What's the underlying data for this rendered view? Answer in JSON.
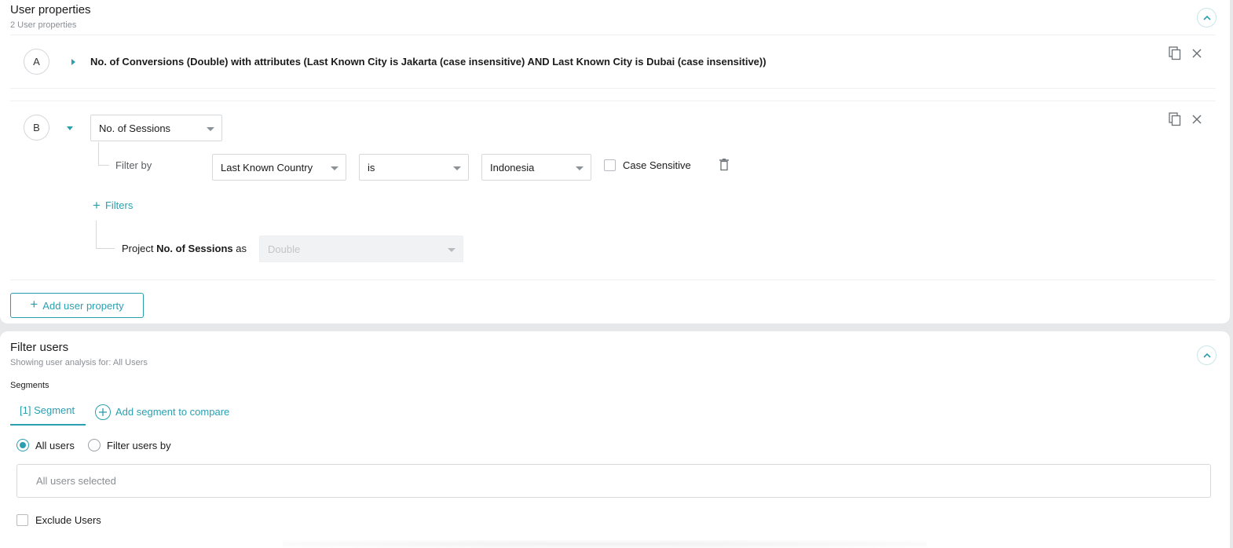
{
  "user_properties": {
    "title": "User properties",
    "subtitle": "2 User properties",
    "rows": [
      {
        "letter": "A",
        "summary": "No. of Conversions (Double) with attributes (Last Known City is Jakarta (case insensitive) AND Last Known City is Dubai (case insensitive))"
      },
      {
        "letter": "B",
        "property_select": "No. of Sessions",
        "filter_label": "Filter by",
        "filter_attribute": "Last Known Country",
        "filter_operator": "is",
        "filter_value": "Indonesia",
        "case_sensitive_label": "Case Sensitive",
        "add_filters_label": "Filters",
        "project_prefix": "Project",
        "project_property": "No. of Sessions",
        "project_suffix": "as",
        "project_type_placeholder": "Double"
      }
    ],
    "add_button_label": "Add user property"
  },
  "filter_users": {
    "title": "Filter users",
    "subtitle": "Showing user analysis for: All Users",
    "segments_label": "Segments",
    "segment_tab": "[1] Segment",
    "add_segment_label": "Add segment to compare",
    "radio_all_users": "All users",
    "radio_filter_users": "Filter users by",
    "selection_text": "All users selected",
    "exclude_label": "Exclude Users"
  },
  "colors": {
    "accent": "#2a9fb0",
    "background": "#e6e8ea"
  }
}
